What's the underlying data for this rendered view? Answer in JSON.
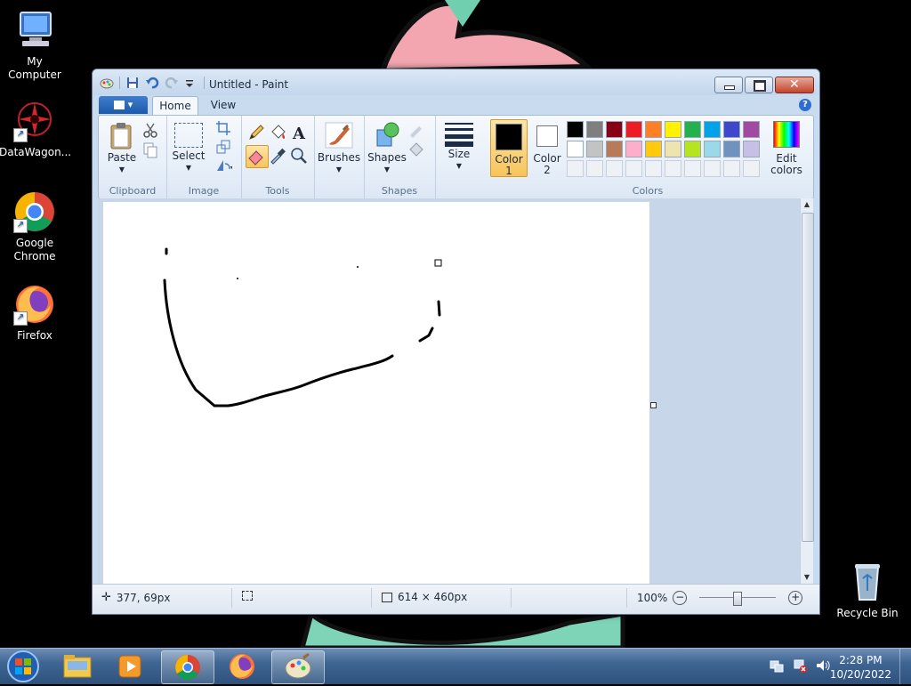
{
  "desktop": {
    "icons": [
      {
        "label": "My Computer"
      },
      {
        "label": "DataWagon..."
      },
      {
        "label": "Google\nChrome"
      },
      {
        "label": "Firefox"
      },
      {
        "label": "Recycle Bin"
      }
    ]
  },
  "window": {
    "title": "Untitled - Paint",
    "file_tab_icon": "paint-menu-icon",
    "tabs": [
      {
        "label": "Home"
      },
      {
        "label": "View"
      }
    ],
    "help_glyph": "?"
  },
  "ribbon": {
    "groups": {
      "clipboard": "Clipboard",
      "image": "Image",
      "tools": "Tools",
      "shapes": "Shapes",
      "colors": "Colors"
    },
    "buttons": {
      "paste": "Paste",
      "select": "Select",
      "brushes": "Brushes",
      "shapes": "Shapes",
      "size": "Size",
      "color1_a": "Color",
      "color1_b": "1",
      "color2_a": "Color",
      "color2_b": "2",
      "edit_a": "Edit",
      "edit_b": "colors"
    },
    "palette_row1": [
      "#000000",
      "#7f7f7f",
      "#880015",
      "#ed1c24",
      "#ff7f27",
      "#fff200",
      "#22b14c",
      "#00a2e8",
      "#3f48cc",
      "#a349a4"
    ],
    "palette_row2": [
      "#ffffff",
      "#c3c3c3",
      "#b97a57",
      "#ffaec9",
      "#ffc90e",
      "#efe4b0",
      "#b5e61d",
      "#99d9ea",
      "#7092be",
      "#c8bfe7"
    ],
    "color1": "#000000",
    "color2": "#ffffff"
  },
  "status": {
    "cursor_pos": "377, 69px",
    "image_size": "614 × 460px",
    "zoom": "100%"
  },
  "taskbar": {
    "time": "2:28 PM",
    "date": "10/20/2022"
  }
}
